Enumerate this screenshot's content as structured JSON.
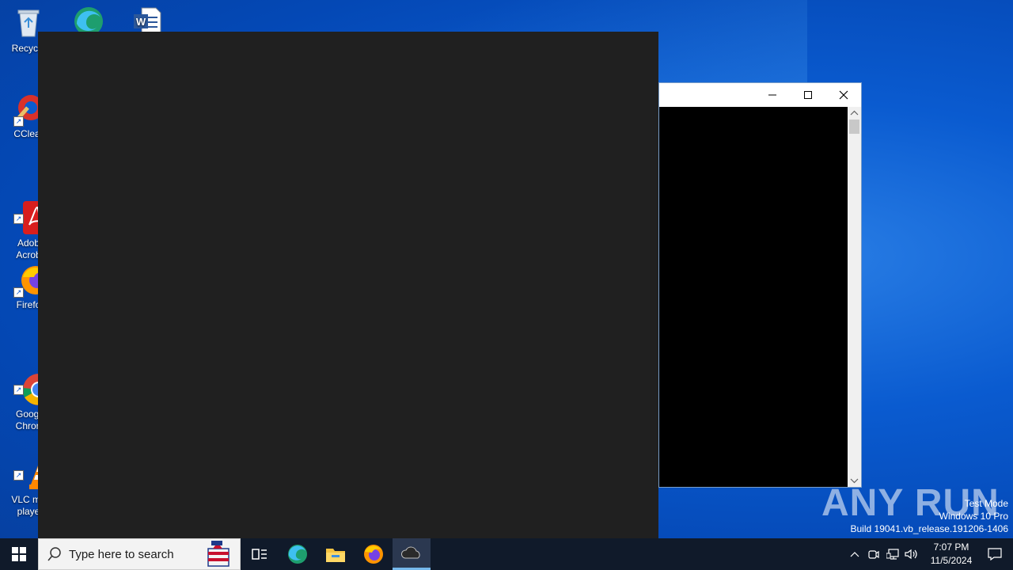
{
  "desktop": {
    "icons": [
      {
        "label": "Recycle",
        "icon": "recycle-bin-icon"
      },
      {
        "label": "",
        "icon": "edge-icon"
      },
      {
        "label": "",
        "icon": "word-icon"
      },
      {
        "label": "CClear",
        "icon": "ccleaner-icon"
      },
      {
        "label": "Adob\nAcrob",
        "icon": "acrobat-icon"
      },
      {
        "label": "Firefo",
        "icon": "firefox-icon"
      },
      {
        "label": "Googl\nChron",
        "icon": "chrome-icon"
      },
      {
        "label": "VLC me\nplaye",
        "icon": "vlc-icon"
      }
    ]
  },
  "console_window": {
    "minimize_icon": "minimize-icon",
    "maximize_icon": "maximize-icon",
    "close_icon": "close-icon"
  },
  "watermark": {
    "brand": "ANY RUN",
    "line1": "Test Mode",
    "line2": "Windows 10 Pro",
    "line3": "Build 19041.vb_release.191206-1406"
  },
  "taskbar": {
    "search_placeholder": "Type here to search",
    "pinned": [
      "task-view-icon",
      "edge-icon",
      "file-explorer-icon",
      "firefox-icon",
      "cloud-app-icon"
    ],
    "clock_time": "7:07 PM",
    "clock_date": "11/5/2024"
  },
  "colors": {
    "desktop_blue": "#0a5bd0",
    "taskbar": "#101a2a",
    "dark_window": "#202020",
    "console_bg": "#000000"
  }
}
